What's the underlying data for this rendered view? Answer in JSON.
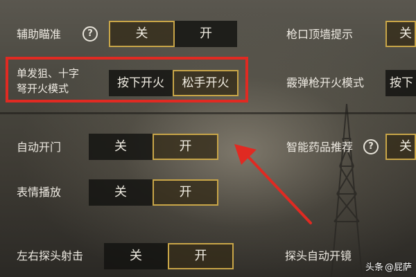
{
  "settings_left": [
    {
      "label": "辅助瞄准",
      "help": "?",
      "off": "关",
      "on": "开",
      "selected": "off"
    },
    {
      "label_line1": "单发狙、十字",
      "label_line2": "弩开火模式",
      "opt_a": "按下开火",
      "opt_b": "松手开火",
      "selected": "opt_b"
    },
    {
      "label": "自动开门",
      "off": "关",
      "on": "开",
      "selected": "on"
    },
    {
      "label": "表情播放",
      "off": "关",
      "on": "开",
      "selected": "on"
    },
    {
      "label": "左右探头射击",
      "off": "关",
      "on": "开",
      "selected": "on"
    }
  ],
  "settings_right": [
    {
      "label": "枪口顶墙提示",
      "partial_opt": "关"
    },
    {
      "label": "霰弹枪开火模式",
      "partial_opt": "按下"
    },
    {
      "label": "智能药品推荐",
      "help": "?",
      "partial_opt": "关"
    },
    {
      "label": "探头自动开镜"
    }
  ],
  "watermark": {
    "prefix": "头条",
    "handle": "@屁萨"
  },
  "colors": {
    "highlight_border": "#e02a22",
    "active_border": "#c9a648",
    "arrow": "#e02a22"
  }
}
